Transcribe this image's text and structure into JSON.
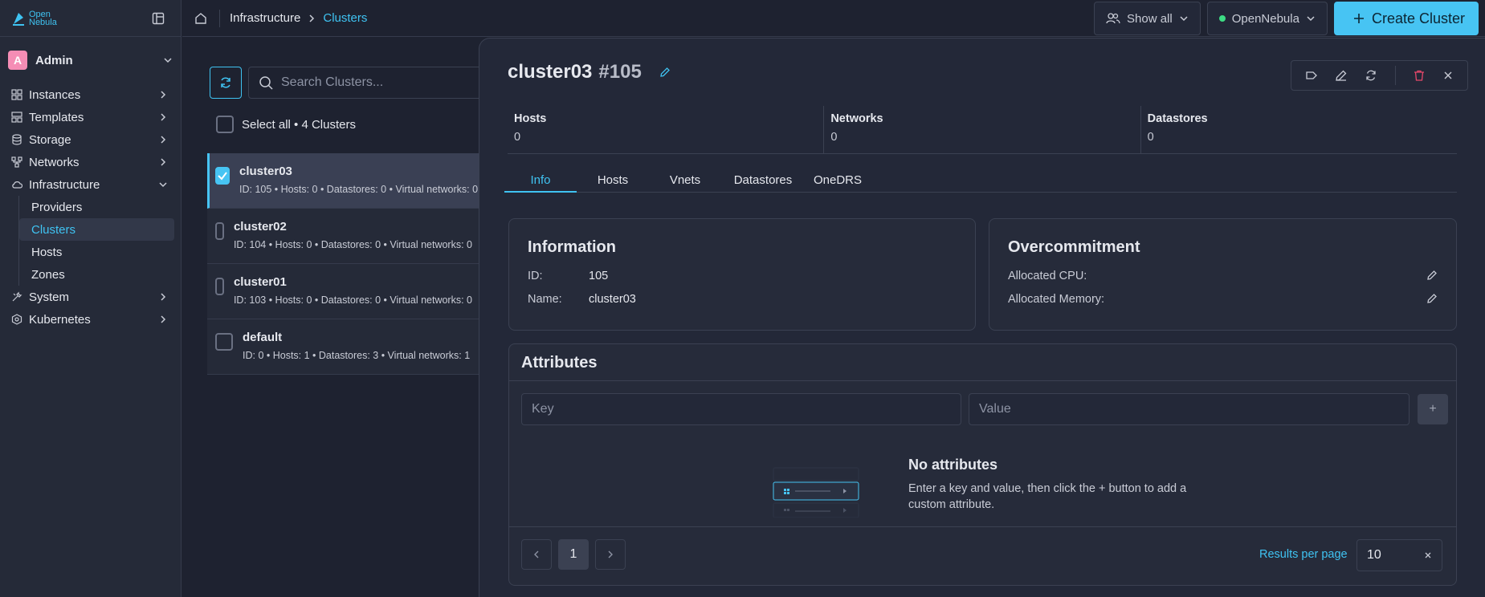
{
  "logo": {
    "line1": "Open",
    "line2": "Nebula"
  },
  "user": {
    "initial": "A",
    "name": "Admin"
  },
  "sidebar": {
    "items": [
      {
        "label": "Instances"
      },
      {
        "label": "Templates"
      },
      {
        "label": "Storage"
      },
      {
        "label": "Networks"
      },
      {
        "label": "Infrastructure"
      },
      {
        "label": "System"
      },
      {
        "label": "Kubernetes"
      }
    ],
    "infrastructure_sub": [
      {
        "label": "Providers"
      },
      {
        "label": "Clusters"
      },
      {
        "label": "Hosts"
      },
      {
        "label": "Zones"
      }
    ]
  },
  "breadcrumb": {
    "parent": "Infrastructure",
    "current": "Clusters"
  },
  "header": {
    "show_all": "Show all",
    "zone": "OpenNebula",
    "create": "Create Cluster"
  },
  "list": {
    "search_placeholder": "Search Clusters...",
    "select_all": "Select all • 4 Clusters",
    "rows": [
      {
        "name": "cluster03",
        "meta": "ID: 105 • Hosts: 0 • Datastores: 0 • Virtual networks: 0"
      },
      {
        "name": "cluster02",
        "meta": "ID: 104 • Hosts: 0 • Datastores: 0 • Virtual networks: 0"
      },
      {
        "name": "cluster01",
        "meta": "ID: 103 • Hosts: 0 • Datastores: 0 • Virtual networks: 0"
      },
      {
        "name": "default",
        "meta": "ID: 0 • Hosts: 1 • Datastores: 3 • Virtual networks: 1"
      }
    ]
  },
  "detail": {
    "name": "cluster03",
    "id": "#105",
    "stats": [
      {
        "label": "Hosts",
        "value": "0"
      },
      {
        "label": "Networks",
        "value": "0"
      },
      {
        "label": "Datastores",
        "value": "0"
      }
    ],
    "tabs": [
      "Info",
      "Hosts",
      "Vnets",
      "Datastores",
      "OneDRS"
    ],
    "information": {
      "title": "Information",
      "id_label": "ID:",
      "id_value": "105",
      "name_label": "Name:",
      "name_value": "cluster03"
    },
    "overcommitment": {
      "title": "Overcommitment",
      "cpu_label": "Allocated CPU:",
      "memory_label": "Allocated Memory:"
    },
    "attributes": {
      "title": "Attributes",
      "key_placeholder": "Key",
      "value_placeholder": "Value",
      "add_label": "+",
      "empty_title": "No attributes",
      "empty_text_1": "Enter a key and value, then click the + button to add a",
      "empty_text_2": "custom attribute."
    },
    "pagination": {
      "page": "1",
      "results_label": "Results per page",
      "results_value": "10"
    }
  }
}
